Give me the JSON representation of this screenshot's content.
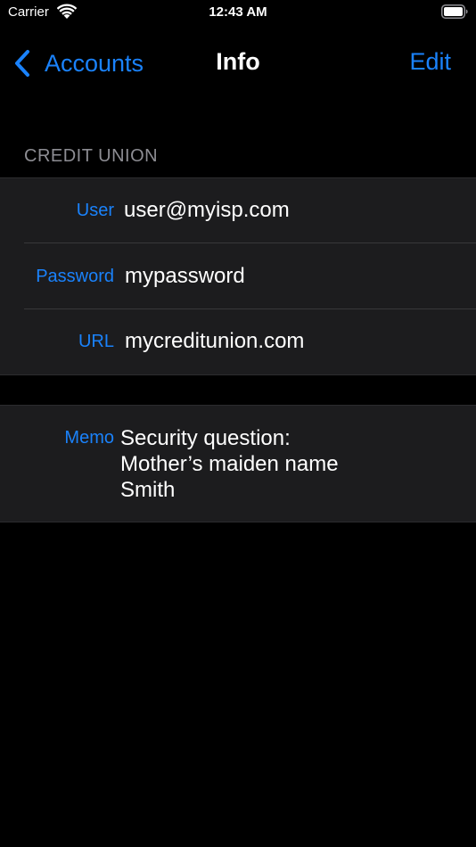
{
  "status_bar": {
    "carrier": "Carrier",
    "time": "12:43 AM",
    "icons": [
      "wifi-icon",
      "battery-icon"
    ]
  },
  "nav": {
    "back_label": "Accounts",
    "title": "Info",
    "edit_label": "Edit",
    "back_icon": "chevron-left-icon"
  },
  "section": {
    "header": "CREDIT UNION"
  },
  "fields": {
    "user": {
      "label": "User",
      "value": "user@myisp.com"
    },
    "password": {
      "label": "Password",
      "value": "mypassword"
    },
    "url": {
      "label": "URL",
      "value": "mycreditunion.com"
    }
  },
  "memo": {
    "label": "Memo",
    "lines": [
      "Security question:",
      "Mother’s maiden name",
      "Smith"
    ]
  },
  "colors": {
    "accent": "#1a82fb",
    "background": "#000000",
    "cell": "#1c1c1e",
    "secondary_text": "#8d8d93"
  }
}
